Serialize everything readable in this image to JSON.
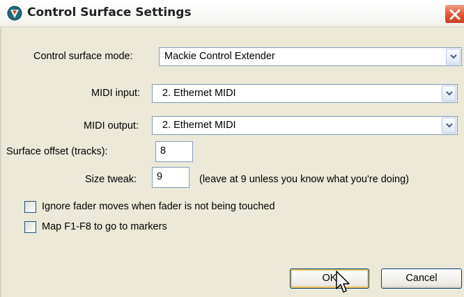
{
  "window": {
    "title": "Control Surface Settings",
    "icon": "reaper-logo-icon",
    "close_icon": "close-icon"
  },
  "form": {
    "mode": {
      "label": "Control surface mode:",
      "value": "Mackie Control Extender"
    },
    "midi_input": {
      "label": "MIDI input:",
      "value": "2. Ethernet MIDI"
    },
    "midi_output": {
      "label": "MIDI output:",
      "value": "2. Ethernet MIDI"
    },
    "surface_offset": {
      "label": "Surface offset (tracks):",
      "value": "8"
    },
    "size_tweak": {
      "label": "Size tweak:",
      "value": "9",
      "hint": "(leave at 9 unless you know what you're doing)"
    },
    "ignore_fader": {
      "label": "Ignore fader moves when fader is not being touched",
      "checked": false
    },
    "map_fkeys": {
      "label": "Map F1-F8 to go to markers",
      "checked": false
    }
  },
  "buttons": {
    "ok": "OK",
    "cancel": "Cancel"
  },
  "colors": {
    "dialog_bg": "#ece9d8",
    "close_button": "#e2552f",
    "field_border": "#7f9db9",
    "default_button_glow": "#f4c35c"
  }
}
